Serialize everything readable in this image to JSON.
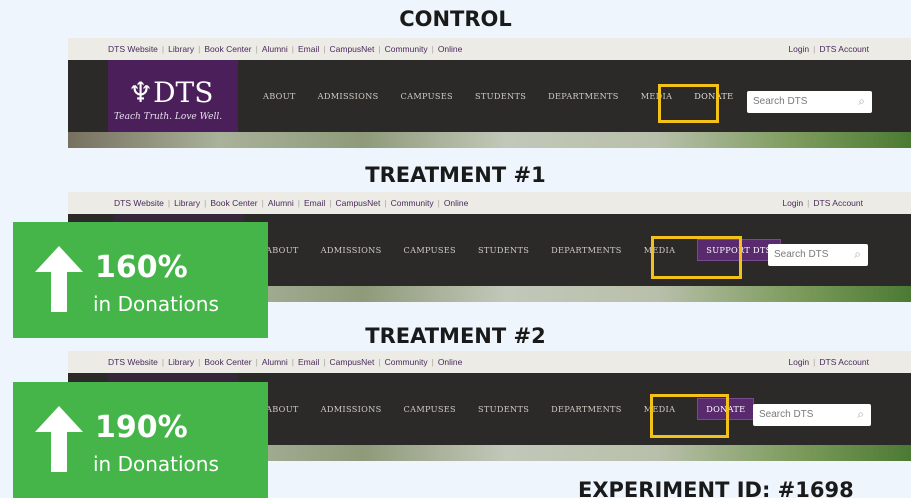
{
  "headings": {
    "control": "CONTROL",
    "treatment1": "TREATMENT #1",
    "treatment2": "TREATMENT #2"
  },
  "utility_nav": {
    "left": [
      "DTS Website",
      "Library",
      "Book Center",
      "Alumni",
      "Email",
      "CampusNet",
      "Community",
      "Online"
    ],
    "right": [
      "Login",
      "DTS Account"
    ]
  },
  "logo": {
    "mark": "DTS",
    "tagline": "Teach Truth. Love Well."
  },
  "main_nav": [
    "ABOUT",
    "ADMISSIONS",
    "CAMPUSES",
    "STUDENTS",
    "DEPARTMENTS",
    "MEDIA"
  ],
  "cta": {
    "control": "DONATE",
    "treatment1": "SUPPORT DTS",
    "treatment2": "DONATE"
  },
  "search": {
    "placeholder": "Search DTS"
  },
  "results": {
    "treatment1": {
      "value": "160%",
      "label": "in Donations"
    },
    "treatment2": {
      "value": "190%",
      "label": "in Donations"
    }
  },
  "experiment_id": "EXPERIMENT ID: #1698",
  "colors": {
    "highlight": "#f2c21a",
    "brand_purple": "#4b1f5a",
    "badge_green": "#45b549",
    "nav_dark": "#2b2a28"
  }
}
